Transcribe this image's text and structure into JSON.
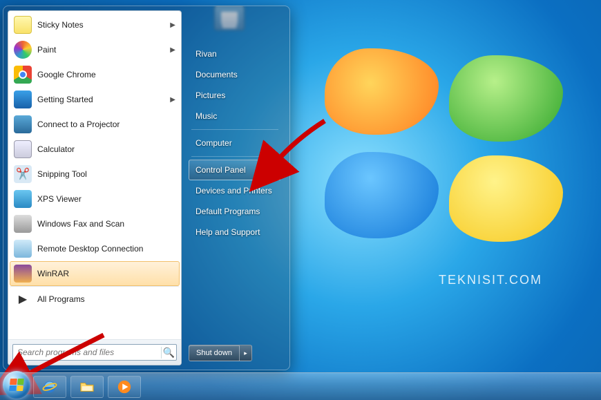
{
  "desktop": {
    "watermark": "TEKNISIT.COM",
    "icon_label": ""
  },
  "start_menu": {
    "programs": [
      {
        "label": "Sticky Notes",
        "icon": "sticky-notes-icon",
        "has_submenu": true
      },
      {
        "label": "Paint",
        "icon": "paint-icon",
        "has_submenu": true
      },
      {
        "label": "Google Chrome",
        "icon": "chrome-icon",
        "has_submenu": false
      },
      {
        "label": "Getting Started",
        "icon": "getting-started-icon",
        "has_submenu": true
      },
      {
        "label": "Connect to a Projector",
        "icon": "projector-icon",
        "has_submenu": false
      },
      {
        "label": "Calculator",
        "icon": "calculator-icon",
        "has_submenu": false
      },
      {
        "label": "Snipping Tool",
        "icon": "snipping-tool-icon",
        "has_submenu": false
      },
      {
        "label": "XPS Viewer",
        "icon": "xps-viewer-icon",
        "has_submenu": false
      },
      {
        "label": "Windows Fax and Scan",
        "icon": "fax-scan-icon",
        "has_submenu": false
      },
      {
        "label": "Remote Desktop Connection",
        "icon": "remote-desktop-icon",
        "has_submenu": false
      },
      {
        "label": "WinRAR",
        "icon": "winrar-icon",
        "has_submenu": false,
        "highlight": true
      }
    ],
    "all_programs_label": "All Programs",
    "search_placeholder": "Search programs and files",
    "right_items": [
      {
        "label": "Rivan",
        "group": 0
      },
      {
        "label": "Documents",
        "group": 0
      },
      {
        "label": "Pictures",
        "group": 0
      },
      {
        "label": "Music",
        "group": 0
      },
      {
        "label": "Computer",
        "group": 1
      },
      {
        "label": "Control Panel",
        "group": 2,
        "selected": true
      },
      {
        "label": "Devices and Printers",
        "group": 2
      },
      {
        "label": "Default Programs",
        "group": 2
      },
      {
        "label": "Help and Support",
        "group": 2
      }
    ],
    "shutdown_label": "Shut down"
  },
  "taskbar": {
    "items": [
      {
        "name": "internet-explorer"
      },
      {
        "name": "file-explorer"
      },
      {
        "name": "windows-media-player"
      }
    ]
  }
}
